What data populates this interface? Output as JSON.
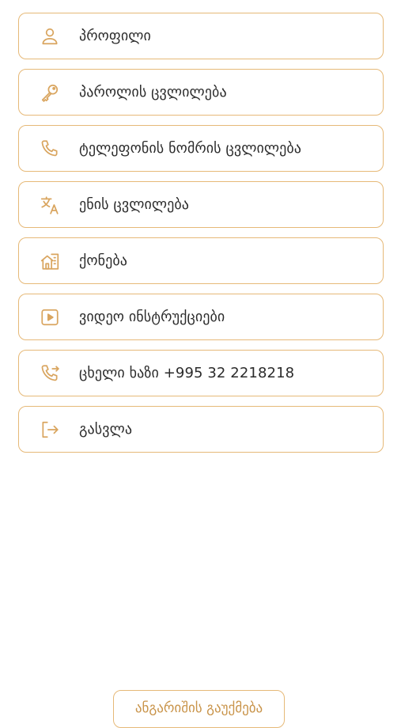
{
  "accent_color": "#d9a55f",
  "menu": {
    "items": [
      {
        "label": "პროფილი",
        "icon": "user-icon"
      },
      {
        "label": "პაროლის ცვლილება",
        "icon": "key-icon"
      },
      {
        "label": "ტელეფონის ნომრის ცვლილება",
        "icon": "phone-icon"
      },
      {
        "label": "ენის ცვლილება",
        "icon": "translate-icon"
      },
      {
        "label": "ქონება",
        "icon": "property-icon"
      },
      {
        "label": "ვიდეო ინსტრუქციები",
        "icon": "video-play-icon"
      },
      {
        "label": "ცხელი ხაზი +995 32 2218218",
        "icon": "phone-forward-icon"
      },
      {
        "label": "გასვლა",
        "icon": "logout-icon"
      }
    ]
  },
  "footer": {
    "report_button_label": "ანგარიშის გაუქმება"
  }
}
